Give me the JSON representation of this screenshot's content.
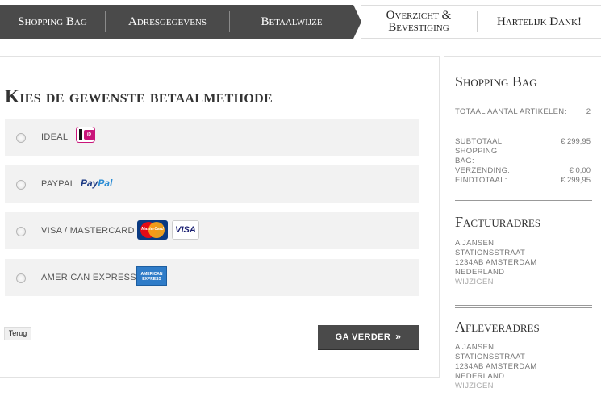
{
  "steps": [
    {
      "label": "Shopping Bag"
    },
    {
      "label": "Adresgegevens"
    },
    {
      "label": "Betaalwijze"
    },
    {
      "label_line1": "Overzicht &",
      "label_line2": "Bevestiging"
    },
    {
      "label": "Hartelijk Dank!"
    }
  ],
  "main": {
    "title": "Kies de gewenste betaalmethode",
    "methods": [
      {
        "label": "IDEAL",
        "icon": "ideal-logo"
      },
      {
        "label": "PAYPAL",
        "icon": "paypal-logo",
        "logo_a": "Pay",
        "logo_b": "Pal"
      },
      {
        "label": "VISA / MASTERCARD",
        "icon": "card-logos",
        "visa": "VISA",
        "mastercard": "MasterCard"
      },
      {
        "label": "AMERICAN EXPRESS",
        "icon": "amex-logo",
        "amex_line1": "AMERICAN",
        "amex_line2": "EXPRESS"
      }
    ],
    "back_label": "Terug",
    "next_label": "GA VERDER",
    "next_icon": "»"
  },
  "sidebar": {
    "bag": {
      "title": "Shopping Bag",
      "total_items_label": "Totaal aantal artikelen:",
      "total_items_value": "2",
      "subtotal_label": "Subtotaal Shopping Bag:",
      "subtotal_value": "€ 299,95",
      "shipping_label": "Verzending:",
      "shipping_value": "€ 0,00",
      "total_label": "Eindtotaal:",
      "total_value": "€ 299,95"
    },
    "invoice": {
      "title": "Factuuradres",
      "name": "A JANSEN",
      "street": "STATIONSSTRAAT",
      "city": "1234AB AMSTERDAM",
      "country": "NEDERLAND",
      "edit": "WIJZIGEN"
    },
    "delivery": {
      "title": "Afleveradres",
      "name": "A JANSEN",
      "street": "STATIONSSTRAAT",
      "city": "1234AB AMSTERDAM",
      "country": "NEDERLAND",
      "edit": "WIJZIGEN"
    }
  },
  "colors": {
    "dark": "#4a4a4a",
    "panel": "#f2f2f2",
    "ideal": "#c9147a",
    "paypal": "#1d3b84"
  }
}
